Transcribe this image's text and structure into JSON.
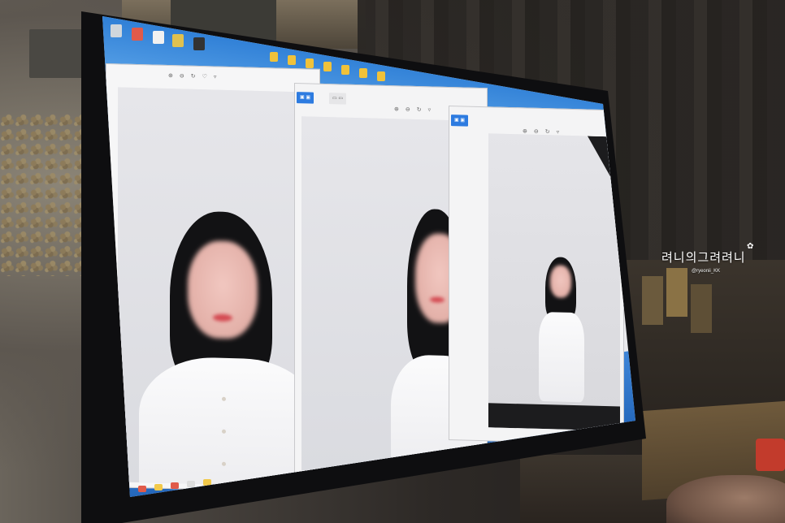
{
  "watermark": {
    "title": "려니의그려려니",
    "handle": "@ryeonii_KK",
    "flower": "✿"
  },
  "screen": {
    "panels": [
      {
        "tab_primary": "",
        "tab_secondary": ""
      },
      {
        "tab_primary": "",
        "tab_secondary": ""
      },
      {
        "tab_primary": "",
        "tab_secondary": ""
      }
    ]
  },
  "colors": {
    "taskbar": "#2d7be0",
    "lips": "#d44a52",
    "hair": "#121214"
  }
}
